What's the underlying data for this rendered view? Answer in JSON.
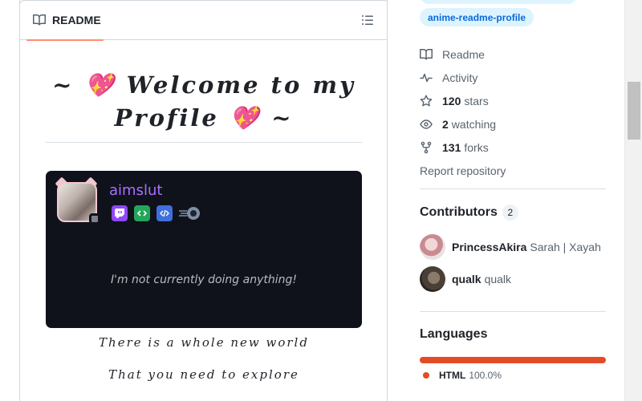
{
  "readme": {
    "tab_label": "README",
    "welcome_line1": "~ 💖 Welcome to my",
    "welcome_line2": "Profile 💖 ~",
    "discord": {
      "username": "aimslut",
      "activity": "I'm not currently doing anything!",
      "badges": [
        "twitch-badge",
        "active-developer-badge",
        "developer-badge",
        "hypesquad-badge"
      ]
    },
    "poem_line1": "There is a whole new world",
    "poem_line2": "That you need to explore"
  },
  "sidebar": {
    "topic": "anime-readme-profile",
    "meta": {
      "readme_label": "Readme",
      "activity_label": "Activity",
      "stars_count": "120",
      "stars_label": "stars",
      "watching_count": "2",
      "watching_label": "watching",
      "forks_count": "131",
      "forks_label": "forks",
      "report_label": "Report repository"
    },
    "contributors": {
      "title": "Contributors",
      "count": "2",
      "list": [
        {
          "login": "PrincessAkira",
          "name": "Sarah | Xayah"
        },
        {
          "login": "qualk",
          "name": "qualk"
        }
      ]
    },
    "languages": {
      "title": "Languages",
      "items": [
        {
          "name": "HTML",
          "percent": "100.0%",
          "color": "#e34c26"
        }
      ]
    }
  },
  "colors": {
    "accent_underline": "#fd8c73",
    "link_blue": "#0969da",
    "discord_bg": "#0f121b",
    "username_purple": "#a970ff"
  }
}
